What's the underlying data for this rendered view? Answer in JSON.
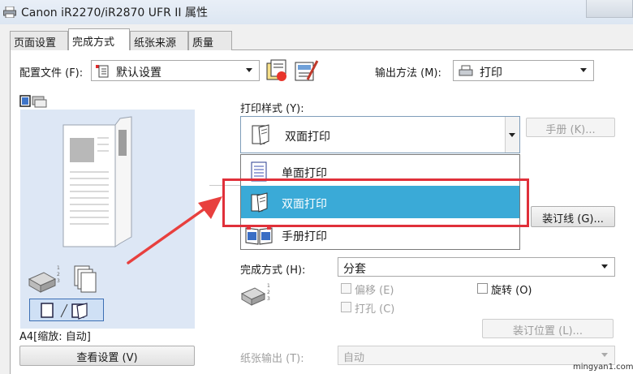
{
  "window": {
    "title": "Canon iR2270/iR2870 UFR II 属性"
  },
  "tabs": [
    {
      "label": "页面设置"
    },
    {
      "label": "完成方式"
    },
    {
      "label": "纸张来源"
    },
    {
      "label": "质量"
    }
  ],
  "profile": {
    "label": "配置文件 (F):",
    "value": "默认设置"
  },
  "output": {
    "label": "输出方法 (M):",
    "value": "打印"
  },
  "print_style": {
    "label": "打印样式 (Y):",
    "value": "双面打印",
    "options": [
      "单面打印",
      "双面打印",
      "手册打印"
    ],
    "selected_index": 1
  },
  "buttons": {
    "booklet": "手册 (K)...",
    "binding_line": "装订线 (G)...",
    "staple_position": "装订位置 (L)...",
    "view_settings": "查看设置 (V)"
  },
  "finishing": {
    "label": "完成方式 (H):",
    "value": "分套"
  },
  "checks": {
    "offset": "偏移 (E)",
    "rotate": "旋转 (O)",
    "punch": "打孔 (C)"
  },
  "paper_output": {
    "label": "纸张输出 (T):",
    "value": "自动"
  },
  "preview": {
    "size_text": "A4[缩放: 自动]"
  },
  "watermark": "mingyan1.com",
  "colors": {
    "accent_selection": "#3aaad7",
    "highlight_box": "#e0303a",
    "arrow": "#e8403e"
  }
}
